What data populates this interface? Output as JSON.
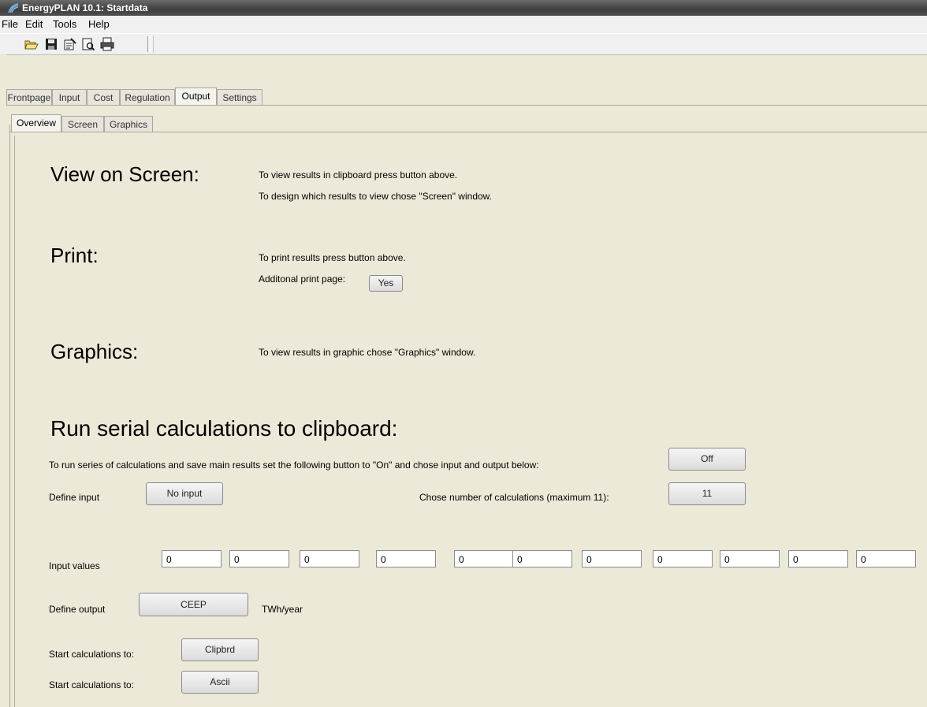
{
  "window": {
    "title": "EnergyPLAN 10.1: Startdata"
  },
  "menu": [
    "File",
    "Edit",
    "Tools",
    "Help"
  ],
  "toolbar": {
    "icons": [
      "open-folder-icon",
      "save-disk-icon",
      "properties-icon",
      "print-preview-icon",
      "print-icon"
    ]
  },
  "main_tabs": [
    "Frontpage",
    "Input",
    "Cost",
    "Regulation",
    "Output",
    "Settings"
  ],
  "main_tab_active": "Output",
  "sub_tabs": [
    "Overview",
    "Screen",
    "Graphics"
  ],
  "sub_tab_active": "Overview",
  "view_on_screen": {
    "heading": "View on Screen:",
    "line1": "To view results in clipboard press button above.",
    "line2": "To design which results to view chose \"Screen\" window."
  },
  "print": {
    "heading": "Print:",
    "line1": "To print results press button above.",
    "additional_label": "Additonal print page:",
    "additional_button": "Yes"
  },
  "graphics": {
    "heading": "Graphics:",
    "line1": "To view results in graphic chose \"Graphics\" window."
  },
  "serial": {
    "heading": "Run serial calculations to clipboard:",
    "instruction": "To run series of calculations and save main results set the following button to \"On\" and chose input and output below:",
    "toggle_button": "Off",
    "define_input_label": "Define input",
    "define_input_button": "No input",
    "num_calc_label": "Chose number of calculations (maximum 11):",
    "num_calc_button": "11",
    "input_values_label": "Input values",
    "input_values": [
      "0",
      "0",
      "0",
      "0",
      "0",
      "0",
      "0",
      "0",
      "0",
      "0",
      "0"
    ],
    "define_output_label": "Define output",
    "define_output_button": "CEEP",
    "define_output_unit": "TWh/year",
    "start_clipbrd_label": "Start calculations to:",
    "start_clipbrd_button": "Clipbrd",
    "start_ascii_label": "Start calculations to:",
    "start_ascii_button": "Ascii"
  },
  "colors": {
    "window_bg": "#ece9d8",
    "titlebar": "#4a4a4a",
    "button_face": "#e6e6e6"
  }
}
